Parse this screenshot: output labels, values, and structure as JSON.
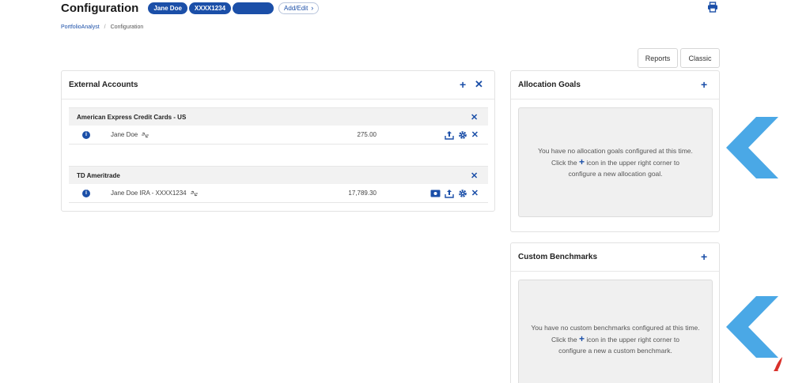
{
  "header": {
    "title": "Configuration",
    "pills": [
      "Jane Doe",
      "XXXX1234",
      ""
    ],
    "add_edit_label": "Add/Edit"
  },
  "breadcrumb": {
    "root": "PortfolioAnalyst",
    "sep": "/",
    "current": "Configuration"
  },
  "view_buttons": {
    "reports": "Reports",
    "classic": "Classic"
  },
  "external_accounts": {
    "title": "External Accounts",
    "groups": [
      {
        "name": "American Express Credit Cards - US",
        "rows": [
          {
            "name": "Jane Doe",
            "value": "275.00"
          }
        ]
      },
      {
        "name": "TD Ameritrade",
        "rows": [
          {
            "name": "Jane Doe IRA - XXXX1234",
            "value": "17,789.30"
          }
        ]
      }
    ]
  },
  "allocation_goals": {
    "title": "Allocation Goals",
    "empty_line1": "You have no allocation goals configured at this time.",
    "empty_line2_pre": "Click the",
    "empty_line2_post": "icon in the upper right corner to",
    "empty_line3": "configure a new allocation goal."
  },
  "custom_benchmarks": {
    "title": "Custom Benchmarks",
    "empty_line1": "You have no custom benchmarks configured at this time.",
    "empty_line2_pre": "Click the",
    "empty_line2_post": "icon in the upper right corner to",
    "empty_line3": "configure a new a custom benchmark."
  },
  "colors": {
    "accent": "#1b4fa8",
    "chevron": "#4aa8e6",
    "logo": "#d9312b"
  },
  "icons": [
    "print-icon",
    "plus-icon",
    "close-icon",
    "info-icon",
    "unlink-icon",
    "upload-icon",
    "gear-icon",
    "card-icon",
    "chevron-right-icon",
    "chevron-left-icon"
  ]
}
